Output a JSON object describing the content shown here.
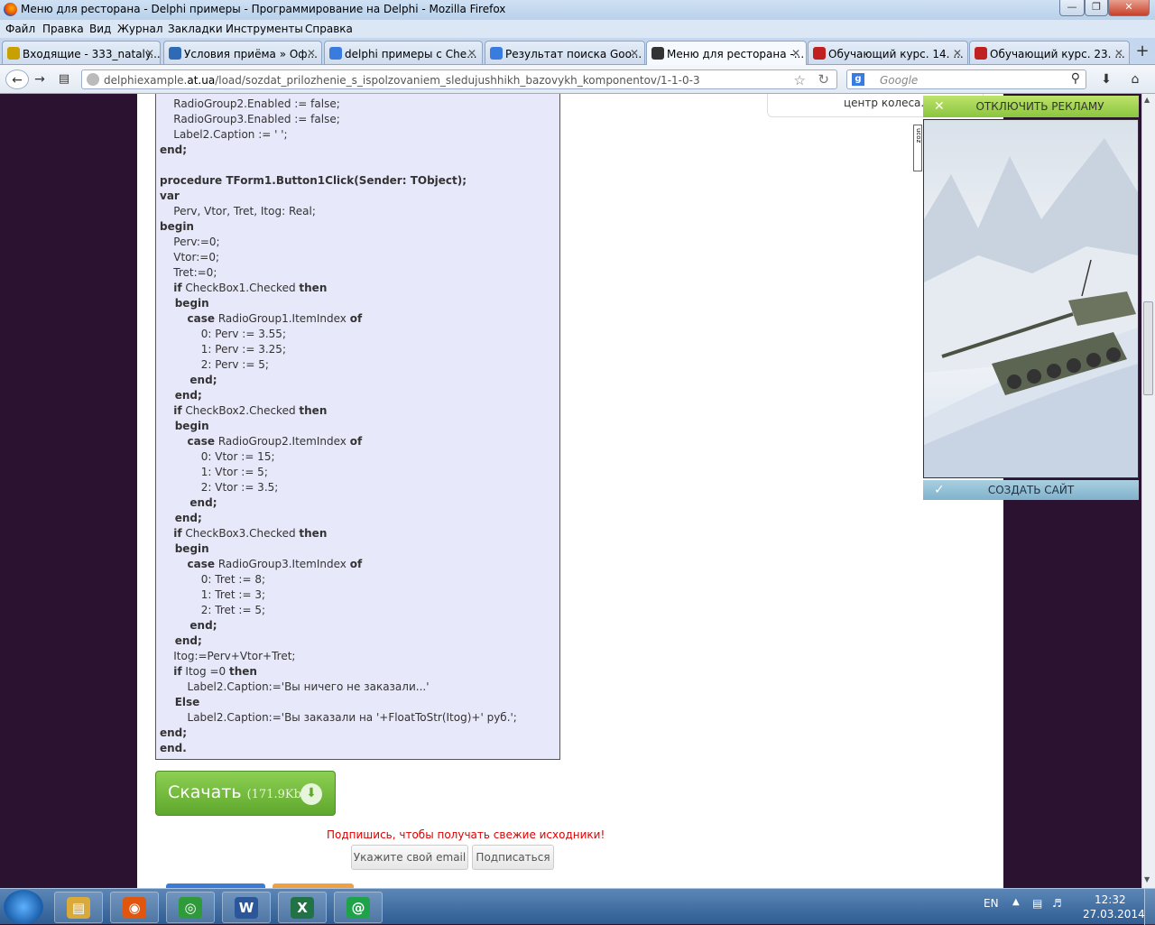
{
  "window": {
    "title": "Меню для ресторана - Delphi примеры - Программирование на Delphi - Mozilla Firefox",
    "minimize": "—",
    "maximize": "❐",
    "close": "✕"
  },
  "menu": [
    "Файл",
    "Правка",
    "Вид",
    "Журнал",
    "Закладки",
    "Инструменты",
    "Справка"
  ],
  "tabs": [
    {
      "label": "Входящие - 333_nataly...",
      "icon_color": "#c8a000"
    },
    {
      "label": "Условия приёма » Оф...",
      "icon_color": "#2f6ab5"
    },
    {
      "label": "delphi примеры с Che...",
      "icon_color": "#3a7be0"
    },
    {
      "label": "Результат поиска Goo...",
      "icon_color": "#3a7be0"
    },
    {
      "label": "Меню для ресторана -...",
      "icon_color": "#333333",
      "active": true
    },
    {
      "label": "Обучающий курс. 14. ...",
      "icon_color": "#c02020"
    },
    {
      "label": "Обучающий курс. 23. ...",
      "icon_color": "#c02020"
    }
  ],
  "nav": {
    "url_domain": "delphiexample.",
    "url_host": "at.ua",
    "url_path": "/load/sozdat_prilozhenie_s_ispolzovaniem_sledujushhikh_bazovykh_komponentov/1-1-0-3",
    "search_placeholder": "Google"
  },
  "code_lines": [
    {
      "t": "    RadioGroup2.Enabled := false;",
      "b": false
    },
    {
      "t": "    RadioGroup3.Enabled := false;",
      "b": false
    },
    {
      "t": "    Label2.Caption := ' ';",
      "b": false
    },
    {
      "t": "end;",
      "b": true
    },
    {
      "t": "",
      "b": false
    },
    {
      "t": "procedure TForm1.Button1Click(Sender: TObject);",
      "b": true
    },
    {
      "t": "var",
      "b": true
    },
    {
      "t": "    Perv, Vtor, Tret, Itog: Real;",
      "b": false
    },
    {
      "t": "begin",
      "b": true
    },
    {
      "t": "    Perv:=0;",
      "b": false
    },
    {
      "t": "    Vtor:=0;",
      "b": false
    },
    {
      "t": "    Tret:=0;",
      "b": false
    },
    {
      "t": "    if CheckBox1.Checked then",
      "b": false
    },
    {
      "t": "    begin",
      "b": true
    },
    {
      "t": "        case RadioGroup1.ItemIndex of",
      "b": false
    },
    {
      "t": "            0: Perv := 3.55;",
      "b": false
    },
    {
      "t": "            1: Perv := 3.25;",
      "b": false
    },
    {
      "t": "            2: Perv := 5;",
      "b": false
    },
    {
      "t": "        end;",
      "b": true
    },
    {
      "t": "    end;",
      "b": true
    },
    {
      "t": "    if CheckBox2.Checked then",
      "b": false
    },
    {
      "t": "    begin",
      "b": true
    },
    {
      "t": "        case RadioGroup2.ItemIndex of",
      "b": false
    },
    {
      "t": "            0: Vtor := 15;",
      "b": false
    },
    {
      "t": "            1: Vtor := 5;",
      "b": false
    },
    {
      "t": "            2: Vtor := 3.5;",
      "b": false
    },
    {
      "t": "        end;",
      "b": true
    },
    {
      "t": "    end;",
      "b": true
    },
    {
      "t": "    if CheckBox3.Checked then",
      "b": false
    },
    {
      "t": "    begin",
      "b": true
    },
    {
      "t": "        case RadioGroup3.ItemIndex of",
      "b": false
    },
    {
      "t": "            0: Tret := 8;",
      "b": false
    },
    {
      "t": "            1: Tret := 3;",
      "b": false
    },
    {
      "t": "            2: Tret := 5;",
      "b": false
    },
    {
      "t": "        end;",
      "b": true
    },
    {
      "t": "    end;",
      "b": true
    },
    {
      "t": "    Itog:=Perv+Vtor+Tret;",
      "b": false
    },
    {
      "t": "    if Itog =0 then",
      "b": false
    },
    {
      "t": "        Label2.Caption:='Вы ничего не заказали...'",
      "b": false
    },
    {
      "t": "    Else",
      "b": true
    },
    {
      "t": "        Label2.Caption:='Вы заказали на '+FloatToStr(Itog)+' руб.';",
      "b": false
    },
    {
      "t": "end;",
      "b": true
    },
    {
      "t": "end.",
      "b": true
    }
  ],
  "download": {
    "label": "Скачать",
    "size": "(171.9Kb)"
  },
  "subscribe": {
    "note": "Подпишись, чтобы получать свежие исходники!",
    "email_placeholder": "Укажите свой email",
    "button": "Подписаться"
  },
  "ad": {
    "top_text": "центр колеса.",
    "close_label": "ОТКЛЮЧИТЬ РЕКЛАМУ",
    "create_label": "СОЗДАТЬ САЙТ",
    "side_label": "ucoz"
  },
  "taskbar": {
    "lang": "EN",
    "time": "12:32",
    "date": "27.03.2014",
    "apps": [
      {
        "name": "explorer",
        "glyph": "▤",
        "color": "#d9a93a"
      },
      {
        "name": "firefox",
        "glyph": "◉",
        "color": "#e0560e"
      },
      {
        "name": "chrome",
        "glyph": "◎",
        "color": "#2e9a3a"
      },
      {
        "name": "word",
        "glyph": "W",
        "color": "#2b579a"
      },
      {
        "name": "excel",
        "glyph": "X",
        "color": "#217346"
      },
      {
        "name": "mail-agent",
        "glyph": "@",
        "color": "#1ea24a"
      }
    ]
  }
}
